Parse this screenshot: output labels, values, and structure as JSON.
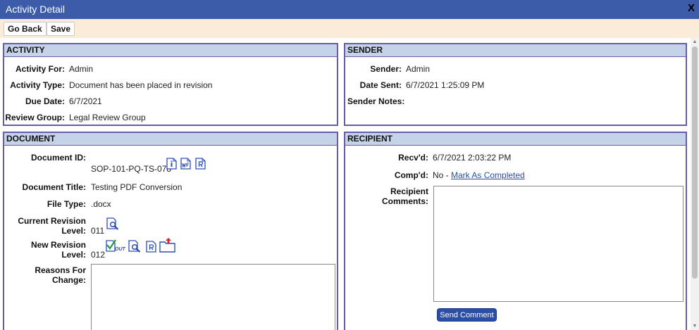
{
  "window": {
    "title": "Activity Detail",
    "close_label": "X"
  },
  "toolbar": {
    "go_back": "Go Back",
    "save": "Save"
  },
  "activity": {
    "header": "ACTIVITY",
    "for_label": "Activity For:",
    "for_value": "Admin",
    "type_label": "Activity Type:",
    "type_value": "Document has been placed in revision",
    "due_label": "Due Date:",
    "due_value": "6/7/2021",
    "group_label": "Review Group:",
    "group_value": "Legal Review Group"
  },
  "sender": {
    "header": "SENDER",
    "sender_label": "Sender:",
    "sender_value": "Admin",
    "date_label": "Date Sent:",
    "date_value": "6/7/2021 1:25:09 PM",
    "notes_label": "Sender Notes:"
  },
  "document": {
    "header": "DOCUMENT",
    "id_label": "Document ID:",
    "id_value": "SOP-101-PQ-TS-078",
    "title_label": "Document Title:",
    "title_value": "Testing PDF Conversion",
    "filetype_label": "File Type:",
    "filetype_value": ".docx",
    "current_rev_label_1": "Current Revision",
    "current_rev_label_2": "Level:",
    "current_rev_value": "011",
    "new_rev_label": "New Revision Level:",
    "new_rev_value": "012",
    "reasons_label_1": "Reasons For",
    "reasons_label_2": "Change:",
    "icons": [
      "info-icon",
      "workflow-icon",
      "report-icon",
      "view-doc-icon",
      "checkout-icon",
      "upload-folder-icon"
    ]
  },
  "recipient": {
    "header": "RECIPIENT",
    "recvd_label": "Recv'd:",
    "recvd_value": "6/7/2021 2:03:22 PM",
    "compd_label": "Comp'd:",
    "compd_value": "No - ",
    "mark_completed": "Mark As Completed",
    "comments_label_1": "Recipient",
    "comments_label_2": "Comments:",
    "send_comment": "Send Comment"
  },
  "colors": {
    "titlebar": "#3c5ba9",
    "toolbar": "#faecd9",
    "panel_header": "#c5d3e8",
    "panel_border": "#6b5aa5",
    "link": "#2a4fa0"
  }
}
